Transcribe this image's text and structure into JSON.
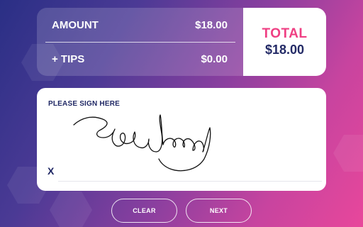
{
  "summary": {
    "amount_label": "AMOUNT",
    "amount_value": "$18.00",
    "tips_label": "+ TIPS",
    "tips_value": "$0.00",
    "total_label": "TOTAL",
    "total_value": "$18.00"
  },
  "signature": {
    "prompt": "PLEASE SIGN HERE",
    "x_mark": "X"
  },
  "buttons": {
    "clear": "CLEAR",
    "next": "NEXT"
  },
  "colors": {
    "total_accent": "#ef3f83",
    "navy_text": "#232a66",
    "bg_start": "#2a2f85",
    "bg_end": "#e8479b"
  },
  "icons": [
    "signature-stroke"
  ]
}
